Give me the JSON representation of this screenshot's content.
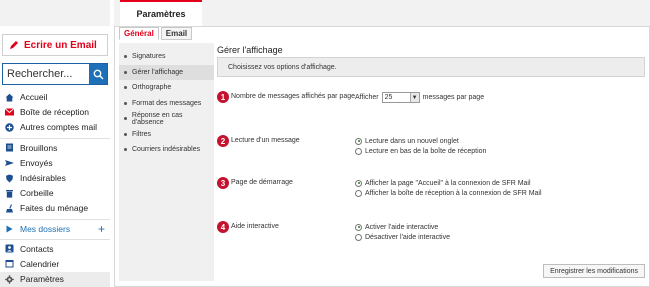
{
  "sidebar": {
    "compose_label": "Ecrire un Email",
    "search_placeholder": "Rechercher...",
    "items": [
      {
        "label": "Accueil",
        "icon": "home-icon"
      },
      {
        "label": "Boîte de réception",
        "icon": "envelope-icon"
      },
      {
        "label": "Autres comptes mail",
        "icon": "plus-circle-icon"
      },
      {
        "label": "Brouillons",
        "icon": "draft-icon"
      },
      {
        "label": "Envoyés",
        "icon": "sent-icon"
      },
      {
        "label": "Indésirables",
        "icon": "shield-icon"
      },
      {
        "label": "Corbeille",
        "icon": "trash-icon"
      },
      {
        "label": "Faites du ménage",
        "icon": "broom-icon"
      },
      {
        "label": "Mes dossiers",
        "icon": "triangle-right-icon"
      },
      {
        "label": "Contacts",
        "icon": "contacts-icon"
      },
      {
        "label": "Calendrier",
        "icon": "calendar-icon"
      },
      {
        "label": "Paramètres",
        "icon": "gear-icon"
      }
    ],
    "add_folder": "+"
  },
  "header": {
    "tab_title": "Paramètres"
  },
  "subtabs": [
    "Général",
    "Email"
  ],
  "settings_nav": [
    "Signatures",
    "Gérer l'affichage",
    "Orthographe",
    "Format des messages",
    "Réponse en cas d'absence",
    "Filtres",
    "Courriers indésirables"
  ],
  "content": {
    "title": "Gérer l'affichage",
    "info": "Choisissez vos options d'affichage.",
    "sections": [
      {
        "num": "1",
        "label": "Nombre de messages affichés par page",
        "prefix": "Afficher",
        "select_value": "25",
        "suffix": "messages par page"
      },
      {
        "num": "2",
        "label": "Lecture d'un message",
        "options": [
          "Lecture dans un nouvel onglet",
          "Lecture en bas de la boîte de réception"
        ],
        "selected": 0
      },
      {
        "num": "3",
        "label": "Page de démarrage",
        "options": [
          "Afficher la page \"Accueil\" à la connexion de SFR Mail",
          "Afficher la boîte de réception à la connexion de SFR Mail"
        ],
        "selected": 0
      },
      {
        "num": "4",
        "label": "Aide interactive",
        "options": [
          "Activer l'aide interactive",
          "Désactiver l'aide interactive"
        ],
        "selected": 0
      }
    ],
    "save_label": "Enregistrer les modifications"
  },
  "colors": {
    "brand_red": "#e2001a",
    "brand_blue": "#1d6fb7"
  }
}
